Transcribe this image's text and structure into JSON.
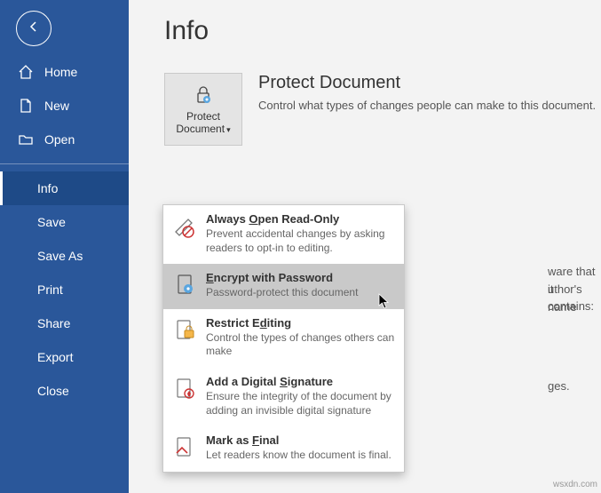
{
  "pageTitle": "Info",
  "sidebar": {
    "items": [
      {
        "label": "Home"
      },
      {
        "label": "New"
      },
      {
        "label": "Open"
      },
      {
        "label": "Info"
      },
      {
        "label": "Save"
      },
      {
        "label": "Save As"
      },
      {
        "label": "Print"
      },
      {
        "label": "Share"
      },
      {
        "label": "Export"
      },
      {
        "label": "Close"
      }
    ]
  },
  "protect": {
    "heading": "Protect Document",
    "body": "Control what types of changes people can make to this document.",
    "buttonLine1": "Protect",
    "buttonLine2": "Document"
  },
  "peek": {
    "line1": "ware that it contains:",
    "line2": "uthor's name",
    "line3": "ges."
  },
  "menu": {
    "items": [
      {
        "label": "Always Open Read-Only",
        "desc": "Prevent accidental changes by asking readers to opt-in to editing."
      },
      {
        "label": "Encrypt with Password",
        "desc": "Password-protect this document"
      },
      {
        "label": "Restrict Editing",
        "desc": "Control the types of changes others can make"
      },
      {
        "label": "Add a Digital Signature",
        "desc": "Ensure the integrity of the document by adding an invisible digital signature"
      },
      {
        "label": "Mark as Final",
        "desc": "Let readers know the document is final."
      }
    ]
  },
  "watermark": "wsxdn.com"
}
